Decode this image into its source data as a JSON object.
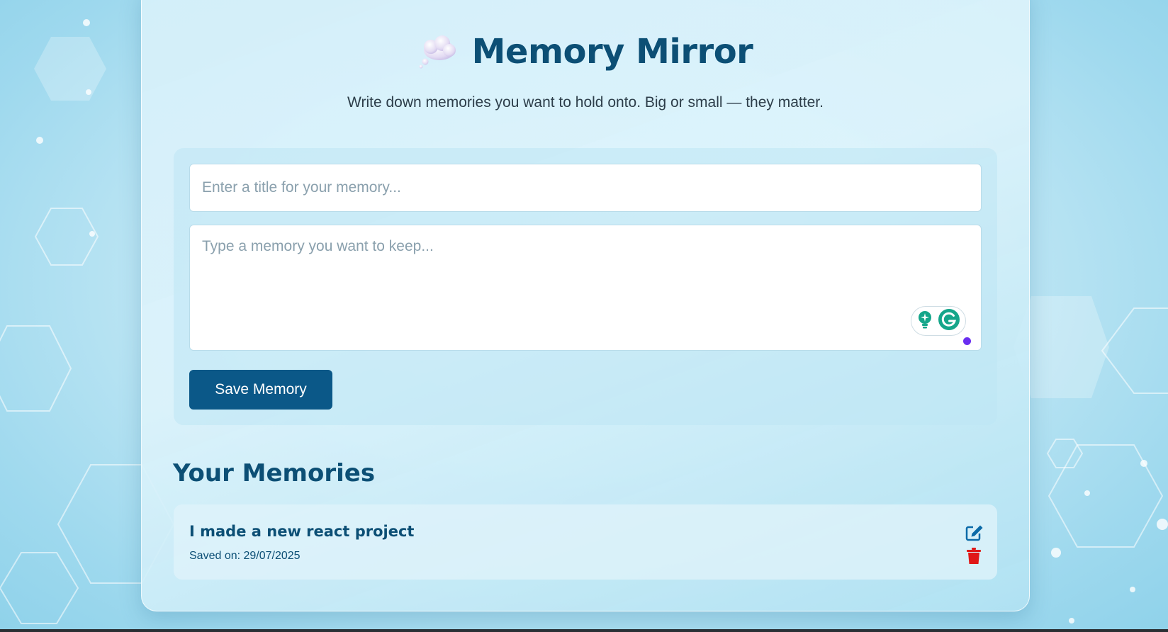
{
  "app": {
    "title": "Memory Mirror",
    "title_emoji_icon": "thought-cloud-icon",
    "subtitle": "Write down memories you want to hold onto. Big or small — they matter."
  },
  "form": {
    "title_input": {
      "value": "",
      "placeholder": "Enter a title for your memory..."
    },
    "memory_textarea": {
      "value": "",
      "placeholder": "Type a memory you want to keep..."
    },
    "save_label": "Save Memory"
  },
  "memories": {
    "heading": "Your Memories",
    "items": [
      {
        "title": "I made a new react project",
        "saved_on": "Saved on: 29/07/2025",
        "actions": [
          "edit-icon",
          "delete-icon"
        ]
      }
    ]
  },
  "colors": {
    "brand_dark": "#0c4f75",
    "button": "#0b5888",
    "delete": "#e01818",
    "grammarly_green": "#15a68a",
    "grammarly_dot": "#6a2ef0"
  }
}
